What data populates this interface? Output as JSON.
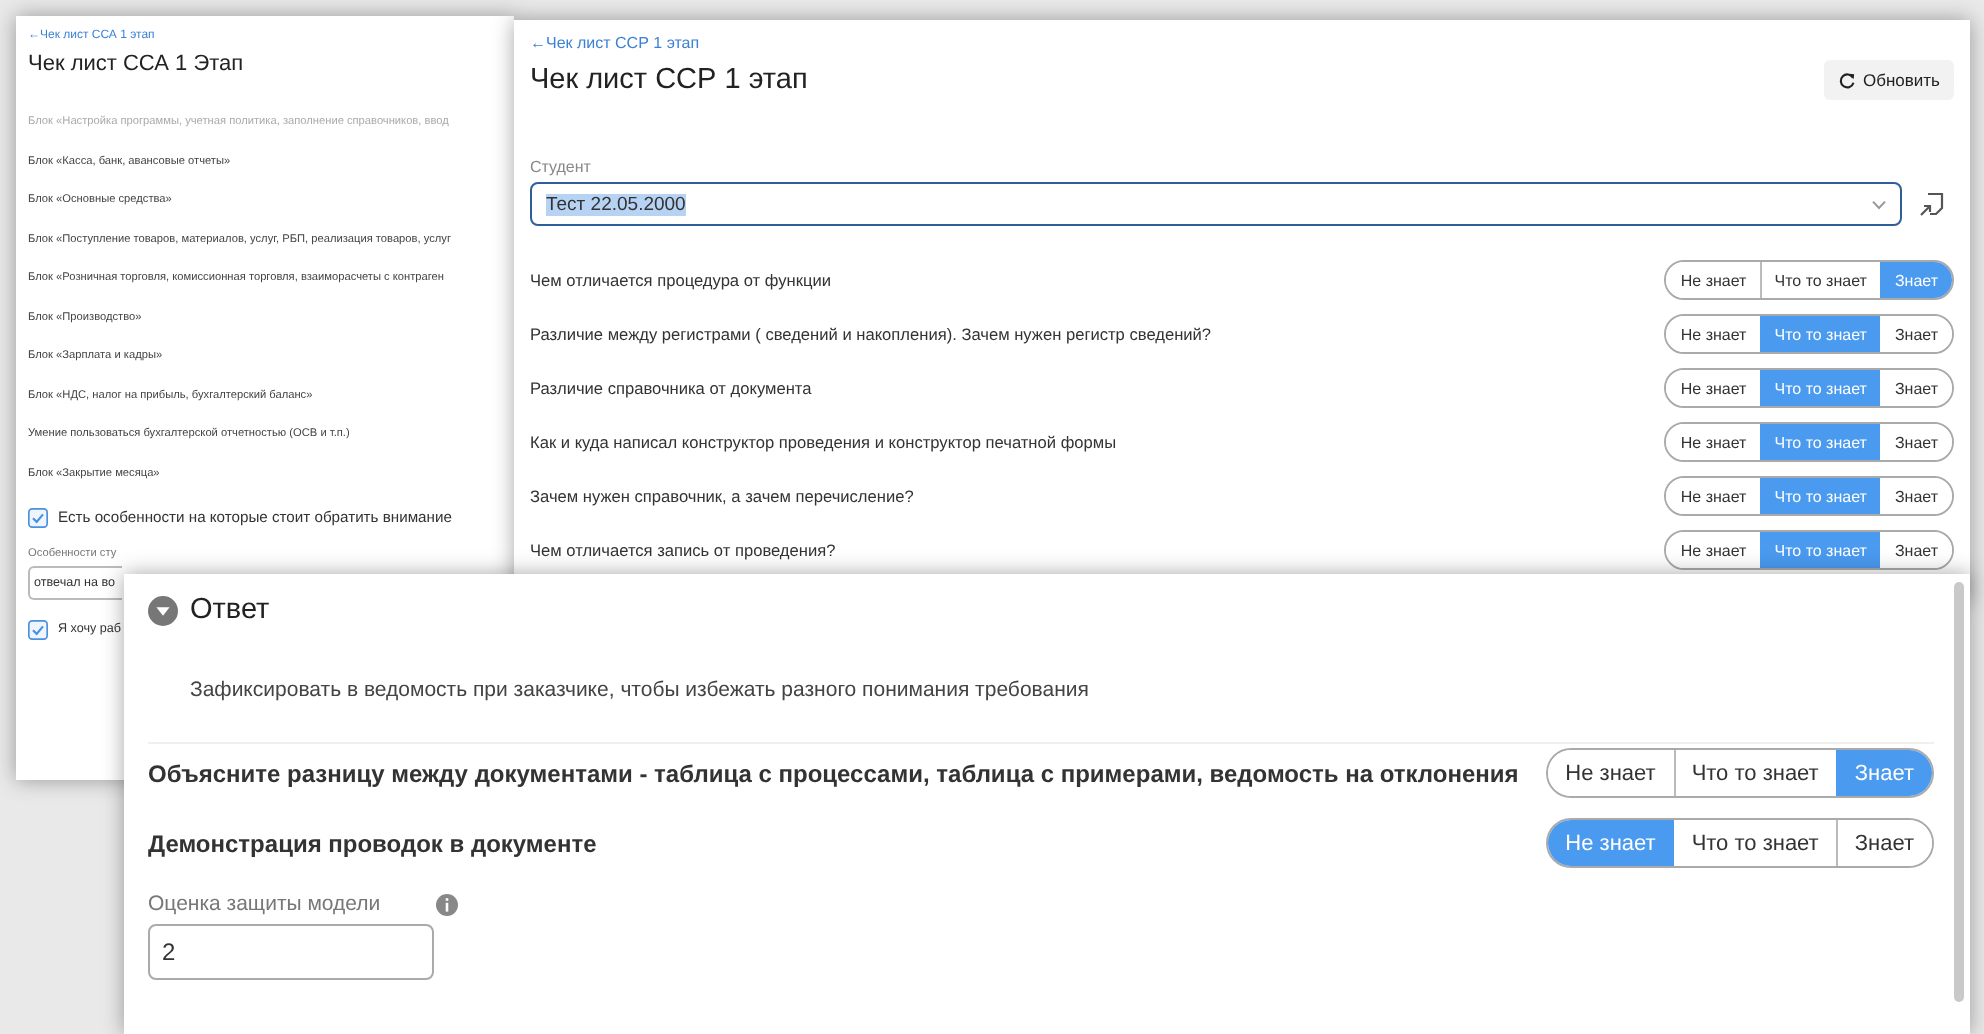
{
  "back_window": {
    "breadcrumb": "←Чек лист ССА 1 этап",
    "title": "Чек лист ССА 1 Этап",
    "items": [
      {
        "label": "Блок «Настройка программы, учетная политика, заполнение справочников, ввод",
        "disabled": true
      },
      {
        "label": "Блок «Касса, банк, авансовые отчеты»",
        "disabled": false
      },
      {
        "label": "Блок «Основные средства»",
        "disabled": false
      },
      {
        "label": "Блок «Поступление товаров, материалов, услуг, РБП, реализация товаров, услуг",
        "disabled": false
      },
      {
        "label": "Блок «Розничная торговля, комиссионная торговля, взаиморасчеты с контраген",
        "disabled": false
      },
      {
        "label": "Блок «Производство»",
        "disabled": false
      },
      {
        "label": "Блок «Зарплата и кадры»",
        "disabled": false
      },
      {
        "label": "Блок «НДС, налог на прибыль, бухгалтерский баланс»",
        "disabled": false
      },
      {
        "label": "Умение пользоваться бухгалтерской отчетностью (ОСВ и т.п.)",
        "disabled": false
      },
      {
        "label": "Блок «Закрытие месяца»",
        "disabled": false
      }
    ],
    "features_checkbox": {
      "label": "Есть особенности на которые стоит обратить внимание",
      "checked": true
    },
    "features_field": {
      "label": "Особенности сту",
      "value": "отвечал на во"
    },
    "work_checkbox": {
      "label": "Я хочу раб",
      "checked": true
    }
  },
  "main_window": {
    "breadcrumb": "←Чек лист ССР 1 этап",
    "title": "Чек лист ССР 1 этап",
    "refresh_button": "Обновить",
    "student": {
      "label": "Студент",
      "value": "Тест 22.05.2000",
      "highlighted": true
    },
    "questions": [
      {
        "text": "Чем отличается процедура от функции",
        "options": [
          {
            "label": "Не знает",
            "selected": false
          },
          {
            "label": "Что то знает",
            "selected": false
          },
          {
            "label": "Знает",
            "selected": true
          }
        ]
      },
      {
        "text": "Различие между регистрами ( сведений и накопления). Зачем нужен регистр сведений?",
        "options": [
          {
            "label": "Не знает",
            "selected": false
          },
          {
            "label": "Что то знает",
            "selected": true
          },
          {
            "label": "Знает",
            "selected": false
          }
        ]
      },
      {
        "text": "Различие справочника от документа",
        "options": [
          {
            "label": "Не знает",
            "selected": false
          },
          {
            "label": "Что то знает",
            "selected": true
          },
          {
            "label": "Знает",
            "selected": false
          }
        ]
      },
      {
        "text": "Как и куда написал конструктор проведения и конструктор печатной формы",
        "options": [
          {
            "label": "Не знает",
            "selected": false
          },
          {
            "label": "Что то знает",
            "selected": true
          },
          {
            "label": "Знает",
            "selected": false
          }
        ]
      },
      {
        "text": "Зачем нужен справочник, а зачем перечисление?",
        "options": [
          {
            "label": "Не знает",
            "selected": false
          },
          {
            "label": "Что то знает",
            "selected": true
          },
          {
            "label": "Знает",
            "selected": false
          }
        ]
      },
      {
        "text": "Чем отличается запись от проведения?",
        "options": [
          {
            "label": "Не знает",
            "selected": false
          },
          {
            "label": "Что то знает",
            "selected": true
          },
          {
            "label": "Знает",
            "selected": false
          }
        ]
      }
    ]
  },
  "answer_panel": {
    "title": "Ответ",
    "expanded": true,
    "note": "Зафиксировать в ведомость при заказчике, чтобы избежать разного понимания требования",
    "questions": [
      {
        "text": "Объясните разницу между документами - таблица с процессами, таблица с примерами, ведомость на отклонения",
        "options": [
          {
            "label": "Не знает",
            "selected": false
          },
          {
            "label": "Что то знает",
            "selected": false
          },
          {
            "label": "Знает",
            "selected": true
          }
        ]
      },
      {
        "text": "Демонстрация проводок в документе",
        "options": [
          {
            "label": "Не знает",
            "selected": true
          },
          {
            "label": "Что то знает",
            "selected": false
          },
          {
            "label": "Знает",
            "selected": false
          }
        ]
      }
    ],
    "score": {
      "label": "Оценка защиты модели",
      "value": "2"
    }
  }
}
